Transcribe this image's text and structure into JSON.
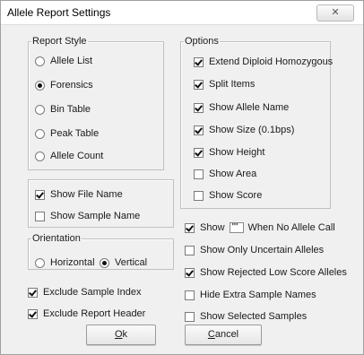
{
  "window": {
    "title": "Allele Report Settings",
    "close_glyph": "✕"
  },
  "report_style": {
    "legend": "Report Style",
    "options": [
      {
        "label": "Allele List",
        "selected": false
      },
      {
        "label": "Forensics",
        "selected": true
      },
      {
        "label": "Bin Table",
        "selected": false
      },
      {
        "label": "Peak Table",
        "selected": false
      },
      {
        "label": "Allele Count",
        "selected": false
      }
    ]
  },
  "file_group": {
    "items": [
      {
        "label": "Show File Name",
        "checked": true
      },
      {
        "label": "Show Sample Name",
        "checked": false
      }
    ]
  },
  "orientation": {
    "legend": "Orientation",
    "options": [
      {
        "label": "Horizontal",
        "selected": false
      },
      {
        "label": "Vertical",
        "selected": true
      }
    ]
  },
  "left_checks": [
    {
      "label": "Exclude Sample Index",
      "checked": true
    },
    {
      "label": "Exclude Report Header",
      "checked": true
    }
  ],
  "options": {
    "legend": "Options",
    "items": [
      {
        "label": "Extend Diploid Homozygous",
        "checked": true
      },
      {
        "label": "Split Items",
        "checked": true
      },
      {
        "label": "Show Allele Name",
        "checked": true
      },
      {
        "label": "Show Size (0.1bps)",
        "checked": true
      },
      {
        "label": "Show Height",
        "checked": true
      },
      {
        "label": "Show Area",
        "checked": false
      },
      {
        "label": "Show Score",
        "checked": false
      }
    ]
  },
  "show_no_call": {
    "checked": true,
    "prefix": "Show",
    "value": "\"\"",
    "suffix": "When No Allele Call"
  },
  "right_checks": [
    {
      "label": "Show Only Uncertain Alleles",
      "checked": false
    },
    {
      "label": "Show Rejected Low Score Alleles",
      "checked": true
    },
    {
      "label": "Hide Extra Sample Names",
      "checked": false
    },
    {
      "label": "Show Selected Samples",
      "checked": false
    }
  ],
  "buttons": {
    "ok_mnemonic": "O",
    "ok_rest": "k",
    "cancel_mnemonic": "C",
    "cancel_rest": "ancel"
  }
}
